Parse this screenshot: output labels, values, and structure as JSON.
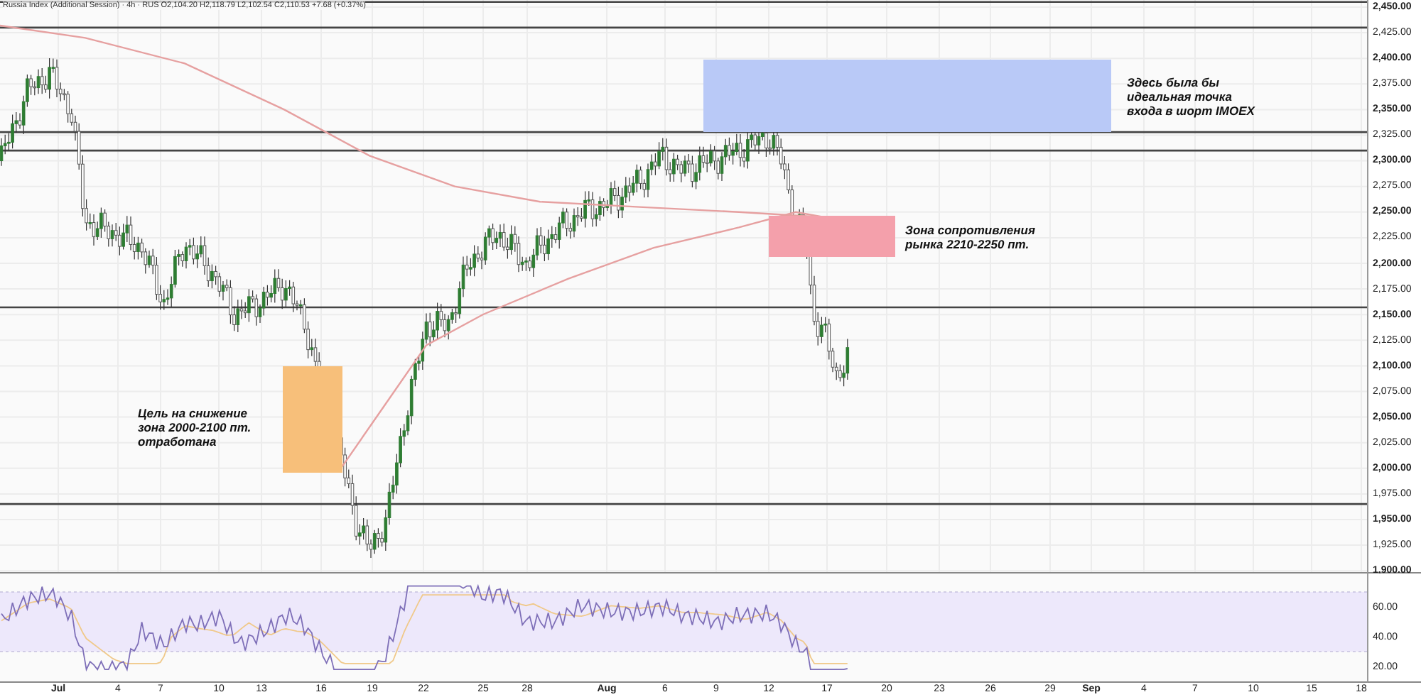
{
  "legend": "Russia Index (Additional Session) · 4h · RUS  O2,104.20  H2,118.79  L2,102.54  C2,110.53  +7.68 (+0.37%)",
  "price_axis": [
    "2,450.00",
    "2,425.00",
    "2,400.00",
    "2,375.00",
    "2,350.00",
    "2,325.00",
    "2,300.00",
    "2,275.00",
    "2,250.00",
    "2,225.00",
    "2,200.00",
    "2,175.00",
    "2,150.00",
    "2,125.00",
    "2,100.00",
    "2,075.00",
    "2,050.00",
    "2,025.00",
    "2,000.00",
    "1,975.00",
    "1,950.00",
    "1,925.00",
    "1,900.00"
  ],
  "rsi_axis": [
    "60.00",
    "40.00",
    "20.00"
  ],
  "time_axis": [
    "Jul",
    "4",
    "7",
    "10",
    "13",
    "16",
    "19",
    "22",
    "25",
    "28",
    "Aug",
    "6",
    "9",
    "12",
    "17",
    "20",
    "23",
    "26",
    "29",
    "Sep",
    "4",
    "7",
    "10",
    "15",
    "18"
  ],
  "zones": [
    {
      "color": "#b9c9f7",
      "text": "Здесь была бы\nидеальная точка\nвхода в шорт IMOEX"
    },
    {
      "color": "#f4a0ab",
      "text": "Зона сопротивления\nрынка 2210-2250 пт."
    },
    {
      "color": "#f7bf7a",
      "text": "Цель на снижение\nзона 2000-2100 пт.\nотработана"
    }
  ]
}
